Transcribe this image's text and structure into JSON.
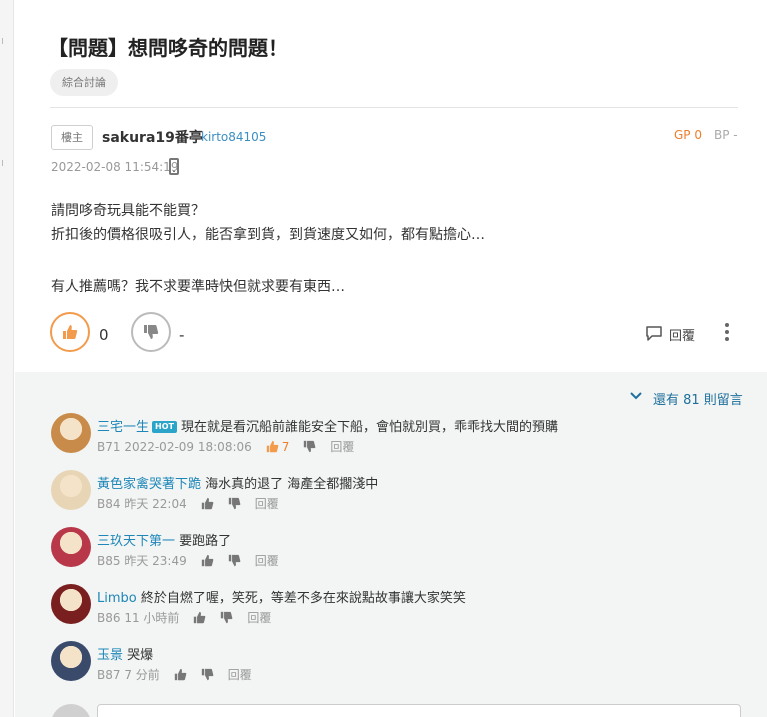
{
  "post": {
    "title": "【問題】想問哆奇的問題！",
    "tag": "綜合討論",
    "floor_label": "樓主",
    "author_name": "sakura19番亭",
    "author_id": "kirto84105",
    "gp": "GP 0",
    "bp": "BP -",
    "time": "2022-02-08 11:54:19",
    "body": [
      "請問哆奇玩具能不能買？",
      "折扣後的價格很吸引人，能否拿到貨，到貨速度又如何，都有點擔心…",
      "",
      "有人推薦嗎？我不求要準時快但就求要有東西…"
    ],
    "up_count": "0",
    "down_count": "-",
    "reply_label": "回覆"
  },
  "comments_section": {
    "expand_label": "還有 81 則留言",
    "hot_badge": "HOT",
    "items": [
      {
        "user": "三宅一生",
        "hot": true,
        "text": "現在就是看沉船前誰能安全下船，會怕就別買，乖乖找大間的預購",
        "floor": "B71",
        "time": "2022-02-09 18:08:06",
        "gp": "7",
        "reply": "回覆",
        "avatar_color": "#c98b4a"
      },
      {
        "user": "黃色家禽哭著下跪",
        "hot": false,
        "text": "海水真的退了 海產全都擱淺中",
        "floor": "B84",
        "time": "昨天 22:04",
        "gp": "",
        "reply": "回覆",
        "avatar_color": "#e8d5b5"
      },
      {
        "user": "三玖天下第一",
        "hot": false,
        "text": "要跑路了",
        "floor": "B85",
        "time": "昨天 23:49",
        "gp": "",
        "reply": "回覆",
        "avatar_color": "#b8384a"
      },
      {
        "user": "Limbo",
        "hot": false,
        "text": "終於自燃了喔，笑死，等差不多在來說點故事讓大家笑笑",
        "floor": "B86",
        "time": "11 小時前",
        "gp": "",
        "reply": "回覆",
        "avatar_color": "#7a1f1f"
      },
      {
        "user": "玉景",
        "hot": false,
        "text": "哭爆",
        "floor": "B87",
        "time": "7 分前",
        "gp": "",
        "reply": "回覆",
        "avatar_color": "#3a4a6b"
      }
    ]
  },
  "icons": {
    "thumb_up": "thumbs-up-icon",
    "thumb_down": "thumbs-down-icon",
    "reply": "speech-bubble-icon",
    "more": "vertical-dots-icon",
    "expand": "chevron-down-icon",
    "device": "phone-icon"
  },
  "colors": {
    "accent_orange": "#ef7d2b",
    "link_blue": "#1f86b8",
    "comment_bg": "#f2f5f4"
  }
}
